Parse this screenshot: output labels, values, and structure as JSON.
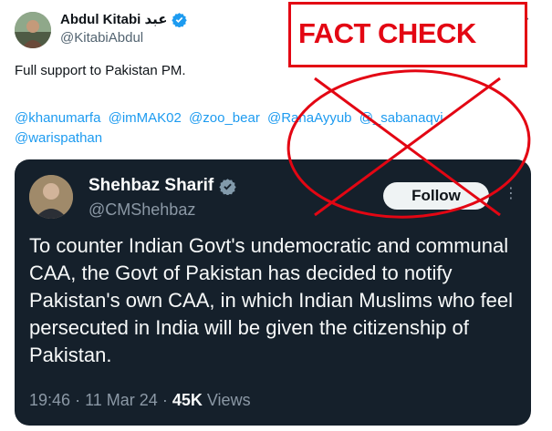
{
  "tweet": {
    "author_name": "Abdul Kitabi عبد",
    "author_handle": "@KitabiAbdul",
    "more_icon": "more-horizontal-icon",
    "text": "Full support to Pakistan PM.",
    "mentions": [
      "@khanumarfa",
      "@imMAK02",
      "@zoo_bear",
      "@RanaAyyub",
      "@_sabanaqvi",
      "@warispathan"
    ],
    "verified_color": "#1d9bf0"
  },
  "quoted_tweet": {
    "author_name": "Shehbaz Sharif",
    "author_handle": "@CMShehbaz",
    "follow_label": "Follow",
    "text": "To counter Indian Govt's undemocratic and communal CAA, the Govt of Pakistan has decided to notify Pakistan's own CAA, in which Indian Muslims who feel persecuted in India will be given the citizenship of Pakistan.",
    "time": "19:46",
    "separator": "·",
    "date": "11 Mar 24",
    "views_count": "45K",
    "views_label": "Views",
    "verified_color": "#829aab"
  },
  "overlay": {
    "label": "FACT CHECK",
    "color": "#e30613"
  }
}
